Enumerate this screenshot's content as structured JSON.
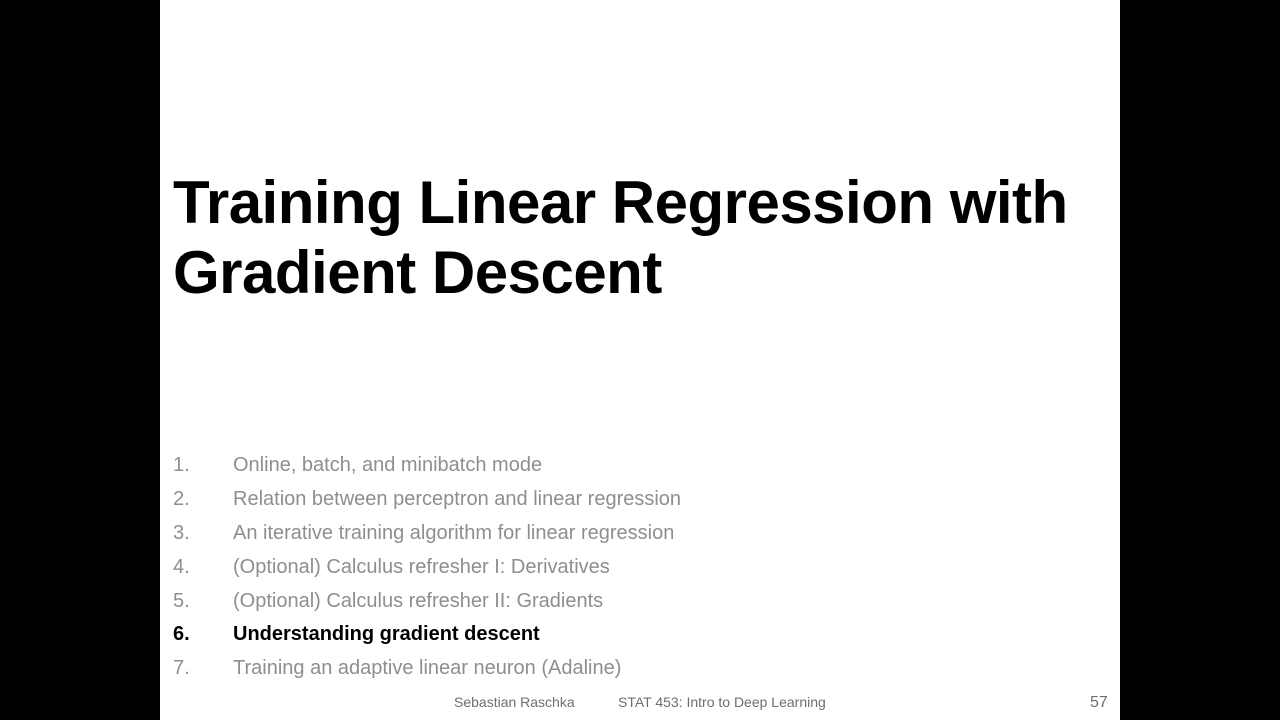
{
  "slide": {
    "title": "Training Linear Regression with Gradient Descent",
    "agenda": [
      {
        "number": "1.",
        "text": "Online, batch, and minibatch mode",
        "active": false
      },
      {
        "number": "2.",
        "text": "Relation between perceptron and linear regression",
        "active": false
      },
      {
        "number": "3.",
        "text": "An iterative training algorithm for linear regression",
        "active": false
      },
      {
        "number": "4.",
        "text": "(Optional) Calculus refresher I: Derivatives",
        "active": false
      },
      {
        "number": "5.",
        "text": "(Optional) Calculus refresher II: Gradients",
        "active": false
      },
      {
        "number": "6.",
        "text": "Understanding gradient descent",
        "active": true
      },
      {
        "number": "7.",
        "text": "Training an adaptive linear neuron (Adaline)",
        "active": false
      }
    ]
  },
  "footer": {
    "author": "Sebastian Raschka",
    "course": "STAT 453: Intro to Deep Learning",
    "page_number": "57"
  },
  "colors": {
    "background": "#000000",
    "slide": "#ffffff",
    "inactive_item": "#8e8e8e",
    "active_item": "#000000",
    "footer_text": "#6e6e6e"
  }
}
